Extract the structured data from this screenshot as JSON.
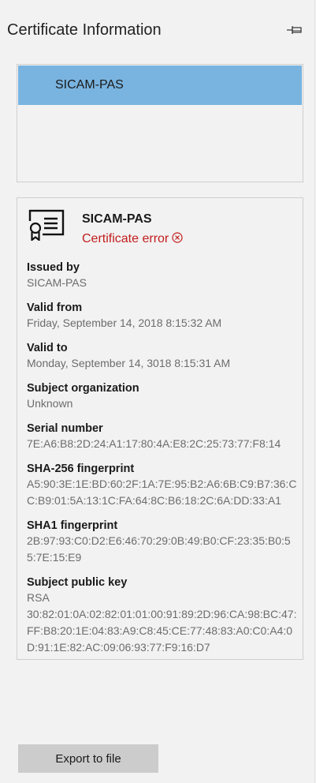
{
  "header": {
    "title": "Certificate Information",
    "pin_icon": "pin-icon"
  },
  "certificate_list": {
    "items": [
      {
        "label": "SICAM-PAS",
        "selected": true
      }
    ]
  },
  "details": {
    "name": "SICAM-PAS",
    "status": "Certificate error",
    "status_color": "#c21d1d",
    "fields": {
      "issued_by": {
        "label": "Issued by",
        "value": "SICAM-PAS"
      },
      "valid_from": {
        "label": "Valid from",
        "value": "Friday, September 14, 2018 8:15:32 AM"
      },
      "valid_to": {
        "label": "Valid to",
        "value": "Monday, September 14, 3018 8:15:31 AM"
      },
      "subject_org": {
        "label": "Subject organization",
        "value": "Unknown"
      },
      "serial_number": {
        "label": "Serial number",
        "value": "7E:A6:B8:2D:24:A1:17:80:4A:E8:2C:25:73:77:F8:14"
      },
      "sha256": {
        "label": "SHA-256 fingerprint",
        "value": "A5:90:3E:1E:BD:60:2F:1A:7E:95:B2:A6:6B:C9:B7:36:CC:B9:01:5A:13:1C:FA:64:8C:B6:18:2C:6A:DD:33:A1"
      },
      "sha1": {
        "label": "SHA1 fingerprint",
        "value": "2B:97:93:C0:D2:E6:46:70:29:0B:49:B0:CF:23:35:B0:55:7E:15:E9"
      },
      "public_key": {
        "label": "Subject public key",
        "value": "RSA\n30:82:01:0A:02:82:01:01:00:91:89:2D:96:CA:98:BC:47:FF:B8:20:1E:04:83:A9:C8:45:CE:77:48:83:A0:C0:A4:0D:91:1E:82:AC:09:06:93:77:F9:16:D7"
      }
    }
  },
  "export_button": {
    "label": "Export to file"
  }
}
